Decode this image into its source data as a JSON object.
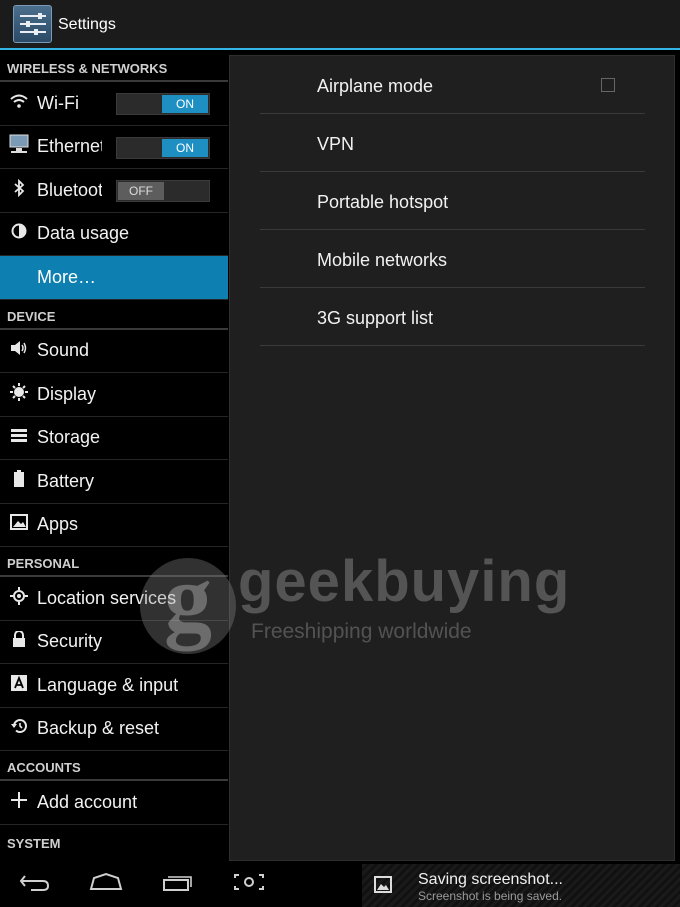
{
  "action_bar": {
    "title": "Settings",
    "icon": "settings-app-icon"
  },
  "sections": {
    "wireless": "WIRELESS & NETWORKS",
    "device": "DEVICE",
    "personal": "PERSONAL",
    "accounts": "ACCOUNTS",
    "system": "SYSTEM"
  },
  "wireless_items": [
    {
      "label": "Wi-Fi",
      "icon": "wifi-icon",
      "toggle": "ON"
    },
    {
      "label": "Ethernet",
      "icon": "ethernet-icon",
      "toggle": "ON"
    },
    {
      "label": "Bluetooth",
      "icon": "bluetooth-icon",
      "toggle": "OFF"
    },
    {
      "label": "Data usage",
      "icon": "data-usage-icon"
    },
    {
      "label": "More…",
      "selected": true
    }
  ],
  "device_items": [
    {
      "label": "Sound",
      "icon": "speaker-icon"
    },
    {
      "label": "Display",
      "icon": "display-icon"
    },
    {
      "label": "Storage",
      "icon": "storage-icon"
    },
    {
      "label": "Battery",
      "icon": "battery-icon"
    },
    {
      "label": "Apps",
      "icon": "apps-icon"
    }
  ],
  "personal_items": [
    {
      "label": "Location services",
      "icon": "location-icon"
    },
    {
      "label": "Security",
      "icon": "lock-icon"
    },
    {
      "label": "Language & input",
      "icon": "keyboard-icon"
    },
    {
      "label": "Backup & reset",
      "icon": "backup-icon"
    }
  ],
  "accounts_items": [
    {
      "label": "Add account",
      "icon": "add-icon"
    }
  ],
  "more_panel": [
    {
      "label": "Airplane mode",
      "checkbox": false
    },
    {
      "label": "VPN"
    },
    {
      "label": "Portable hotspot"
    },
    {
      "label": "Mobile networks"
    },
    {
      "label": "3G support list"
    }
  ],
  "watermark": {
    "brand": "geekbuying",
    "tagline": "Freeshipping worldwide"
  },
  "notification": {
    "title": "Saving screenshot...",
    "subtitle": "Screenshot is being saved.",
    "icon": "image-icon"
  },
  "nav": {
    "back": "back-icon",
    "home": "home-icon",
    "recents": "recents-icon",
    "screenshot": "screenshot-icon"
  },
  "colors": {
    "accent": "#33b5e5",
    "selected": "#0d7fb0",
    "toggle_on": "#1d8fc3"
  }
}
